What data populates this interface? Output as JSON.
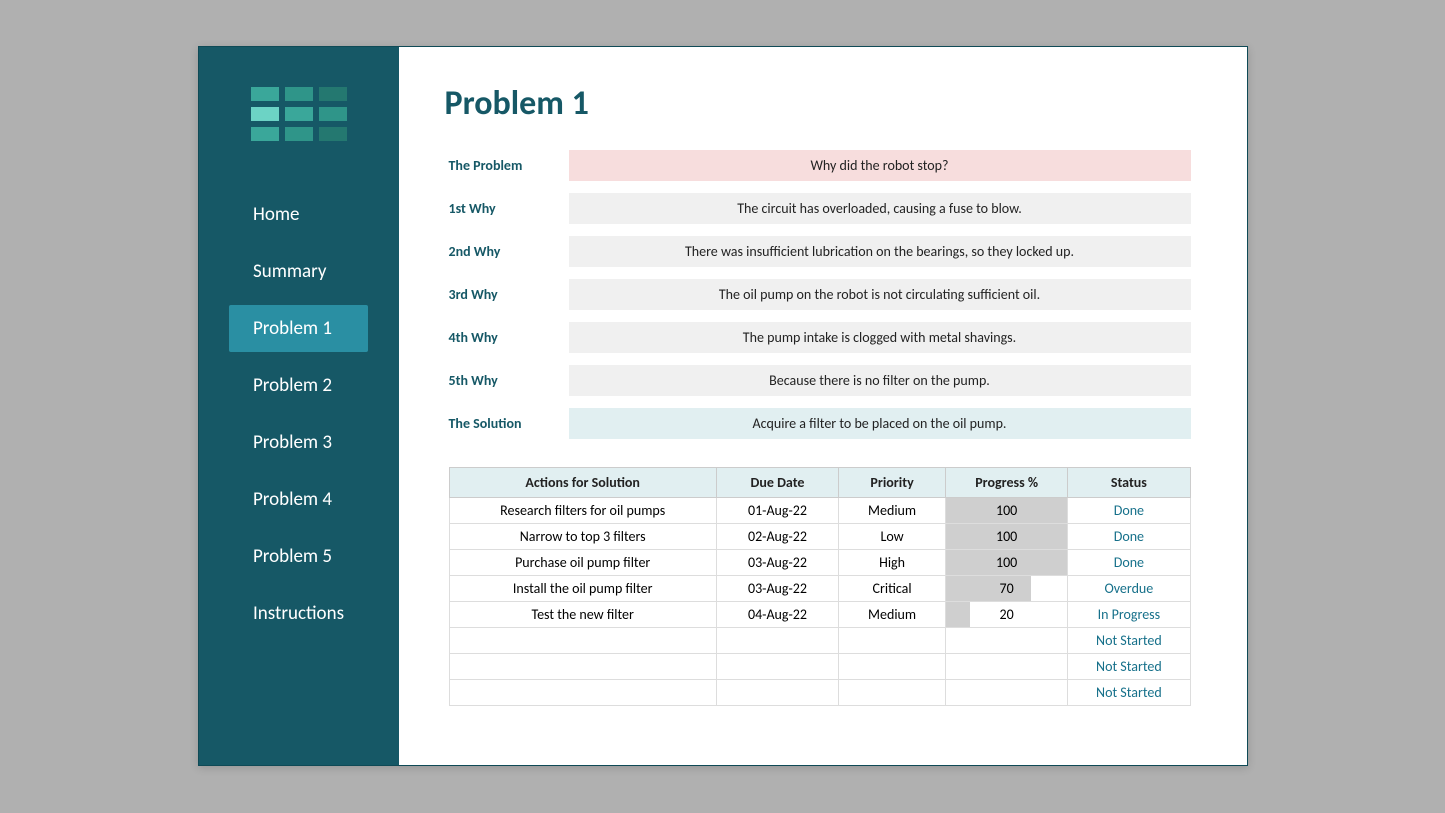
{
  "sidebar": {
    "logo_colors": [
      "#3aa79a",
      "#2f9589",
      "#247870",
      "#6cd3c5",
      "#3aa79a",
      "#2f9589",
      "#3aa79a",
      "#2f9589",
      "#247870"
    ],
    "items": [
      {
        "label": "Home",
        "active": false
      },
      {
        "label": "Summary",
        "active": false
      },
      {
        "label": "Problem 1",
        "active": true
      },
      {
        "label": "Problem 2",
        "active": false
      },
      {
        "label": "Problem 3",
        "active": false
      },
      {
        "label": "Problem 4",
        "active": false
      },
      {
        "label": "Problem 5",
        "active": false
      },
      {
        "label": "Instructions",
        "active": false
      }
    ]
  },
  "title": "Problem 1",
  "rows": [
    {
      "label": "The Problem",
      "value": "Why did the robot stop?",
      "kind": "problem"
    },
    {
      "label": "1st Why",
      "value": "The circuit has overloaded, causing a fuse to blow.",
      "kind": "why"
    },
    {
      "label": "2nd Why",
      "value": "There was insufficient lubrication on the bearings, so they locked up.",
      "kind": "why"
    },
    {
      "label": "3rd Why",
      "value": "The oil pump on the robot is not circulating sufficient oil.",
      "kind": "why"
    },
    {
      "label": "4th Why",
      "value": "The pump intake is clogged with metal shavings.",
      "kind": "why"
    },
    {
      "label": "5th Why",
      "value": "Because there is no filter on the pump.",
      "kind": "why"
    },
    {
      "label": "The Solution",
      "value": "Acquire a filter to be placed on the oil pump.",
      "kind": "solution"
    }
  ],
  "table": {
    "headers": [
      "Actions for Solution",
      "Due Date",
      "Priority",
      "Progress %",
      "Status"
    ],
    "rows": [
      {
        "action": "Research filters for oil pumps",
        "due": "01-Aug-22",
        "priority": "Medium",
        "progress": 100,
        "status": "Done"
      },
      {
        "action": "Narrow to top 3 filters",
        "due": "02-Aug-22",
        "priority": "Low",
        "progress": 100,
        "status": "Done"
      },
      {
        "action": "Purchase oil pump filter",
        "due": "03-Aug-22",
        "priority": "High",
        "progress": 100,
        "status": "Done"
      },
      {
        "action": "Install the oil pump filter",
        "due": "03-Aug-22",
        "priority": "Critical",
        "progress": 70,
        "status": "Overdue"
      },
      {
        "action": "Test the new filter",
        "due": "04-Aug-22",
        "priority": "Medium",
        "progress": 20,
        "status": "In Progress"
      },
      {
        "action": "",
        "due": "",
        "priority": "",
        "progress": null,
        "status": "Not Started"
      },
      {
        "action": "",
        "due": "",
        "priority": "",
        "progress": null,
        "status": "Not Started"
      },
      {
        "action": "",
        "due": "",
        "priority": "",
        "progress": null,
        "status": "Not Started"
      }
    ]
  }
}
